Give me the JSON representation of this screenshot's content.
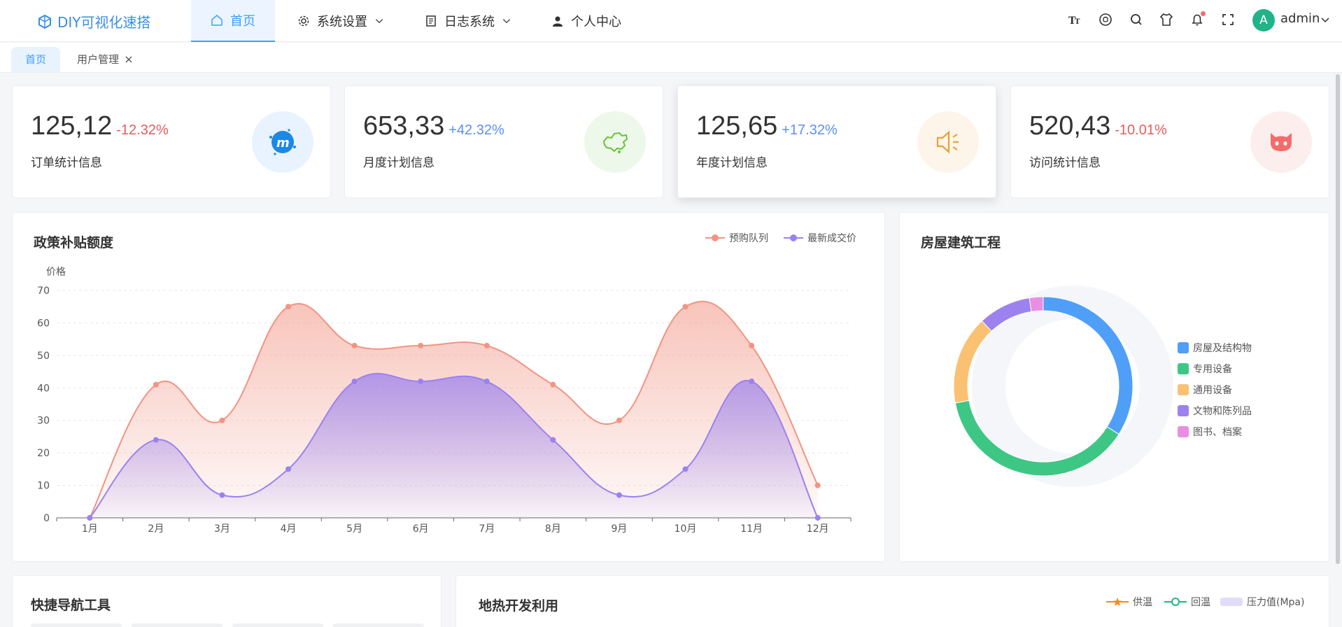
{
  "app": {
    "title": "DIY可视化速搭"
  },
  "nav": {
    "items": [
      {
        "label": "首页"
      },
      {
        "label": "系统设置"
      },
      {
        "label": "日志系统"
      },
      {
        "label": "个人中心"
      }
    ]
  },
  "user": {
    "avatar_letter": "A",
    "name": "admin"
  },
  "tabs": [
    {
      "label": "首页"
    },
    {
      "label": "用户管理"
    }
  ],
  "stats": [
    {
      "value": "125,12",
      "change": "-12.32%",
      "label": "订单统计信息",
      "icon": "meetup-icon",
      "color": "#1e88e5",
      "bg": "#e8f3ff",
      "change_color": "#e65c5c"
    },
    {
      "value": "653,33",
      "change": "+42.32%",
      "label": "月度计划信息",
      "icon": "china-map-icon",
      "color": "#67c23a",
      "bg": "#eef8ea",
      "change_color": "#5b8ff9"
    },
    {
      "value": "125,65",
      "change": "+17.32%",
      "label": "年度计划信息",
      "icon": "speaker-icon",
      "color": "#e6a23c",
      "bg": "#fdf5ea",
      "change_color": "#5b8ff9"
    },
    {
      "value": "520,43",
      "change": "-10.01%",
      "label": "访问统计信息",
      "icon": "github-cat-icon",
      "color": "#f56c6c",
      "bg": "#fdeeee",
      "change_color": "#e65c5c"
    }
  ],
  "line_chart": {
    "title": "政策补贴额度",
    "legend": [
      "预购队列",
      "最新成交价"
    ]
  },
  "pie_chart": {
    "title": "房屋建筑工程"
  },
  "bottom": {
    "left_title": "快捷导航工具",
    "right_title": "地热开发利用",
    "legend": [
      "供温",
      "回温",
      "压力值(Mpa)"
    ]
  },
  "chart_data": [
    {
      "type": "area",
      "title": "政策补贴额度",
      "ylabel": "价格",
      "xlabel": "",
      "categories": [
        "1月",
        "2月",
        "3月",
        "4月",
        "5月",
        "6月",
        "7月",
        "8月",
        "9月",
        "10月",
        "11月",
        "12月"
      ],
      "ylim": [
        0,
        70
      ],
      "yticks": [
        0,
        10,
        20,
        30,
        40,
        50,
        60,
        70
      ],
      "grid": true,
      "legend_position": "top-right",
      "series": [
        {
          "name": "预购队列",
          "color": "#f29483",
          "values": [
            0,
            41,
            30,
            65,
            53,
            53,
            53,
            41,
            30,
            65,
            53,
            10
          ]
        },
        {
          "name": "最新成交价",
          "color": "#9b82ee",
          "values": [
            0,
            24,
            7,
            15,
            42,
            42,
            42,
            24,
            7,
            15,
            42,
            0
          ]
        }
      ]
    },
    {
      "type": "pie",
      "title": "房屋建筑工程",
      "legend_position": "right",
      "slices": [
        {
          "name": "房屋及结构物",
          "value": 34,
          "color": "#4f9ff8"
        },
        {
          "name": "专用设备",
          "value": 38,
          "color": "#3ec784"
        },
        {
          "name": "通用设备",
          "value": 16,
          "color": "#fac172"
        },
        {
          "name": "文物和陈列品",
          "value": 9.5,
          "color": "#9b82ee"
        },
        {
          "name": "图书、档案",
          "value": 2.5,
          "color": "#e98fe2"
        }
      ]
    }
  ]
}
